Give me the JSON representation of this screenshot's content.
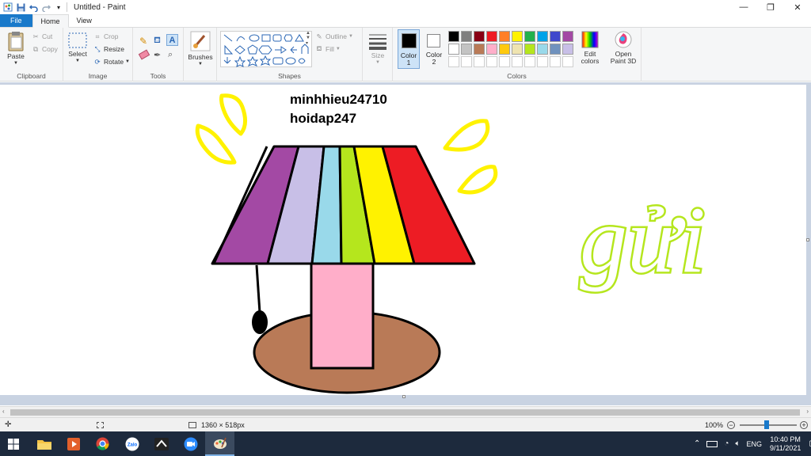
{
  "window": {
    "title": "Untitled - Paint",
    "minimize": "—",
    "restore": "❐",
    "close": "✕"
  },
  "tabs": [
    {
      "label": "File"
    },
    {
      "label": "Home"
    },
    {
      "label": "View"
    }
  ],
  "clipboard": {
    "paste": "Paste",
    "cut": "Cut",
    "copy": "Copy",
    "group_label": "Clipboard"
  },
  "image": {
    "select": "Select",
    "crop": "Crop",
    "resize": "Resize",
    "rotate": "Rotate",
    "group_label": "Image"
  },
  "tools": {
    "group_label": "Tools"
  },
  "brushes": {
    "label": "Brushes"
  },
  "shapes": {
    "outline": "Outline",
    "fill": "Fill",
    "group_label": "Shapes"
  },
  "size": {
    "label": "Size"
  },
  "colors": {
    "color1_label": "Color 1",
    "color2_label": "Color 2",
    "edit_colors": "Edit colors",
    "group_label": "Colors",
    "color1": "#000000",
    "color2": "#ffffff",
    "palette_row1": [
      "#000000",
      "#7f7f7f",
      "#880015",
      "#ed1c24",
      "#ff7f27",
      "#fff200",
      "#22b14c",
      "#00a2e8",
      "#3f48cc",
      "#a349a4"
    ],
    "palette_row2": [
      "#ffffff",
      "#c3c3c3",
      "#b97a57",
      "#ffaec9",
      "#ffc90e",
      "#efe4b0",
      "#b5e61d",
      "#99d9ea",
      "#7092be",
      "#c8bfe7"
    ]
  },
  "paint3d": {
    "label": "Open Paint 3D"
  },
  "canvas_text": {
    "line1": "minhhieu24710",
    "line2": "hoidap247",
    "handwriting": "gửi"
  },
  "lamp": {
    "stripes": [
      "#a349a4",
      "#c8bfe7",
      "#99d9ea",
      "#b5e61d",
      "#fff200",
      "#ed1c24"
    ],
    "stand": "#ffaec9",
    "base": "#b97a57",
    "sparks": "#fff200"
  },
  "status": {
    "dimensions": "1360 × 518px",
    "zoom": "100%"
  },
  "taskbar": {
    "lang": "ENG",
    "time": "10:40 PM",
    "date": "9/11/2021"
  }
}
